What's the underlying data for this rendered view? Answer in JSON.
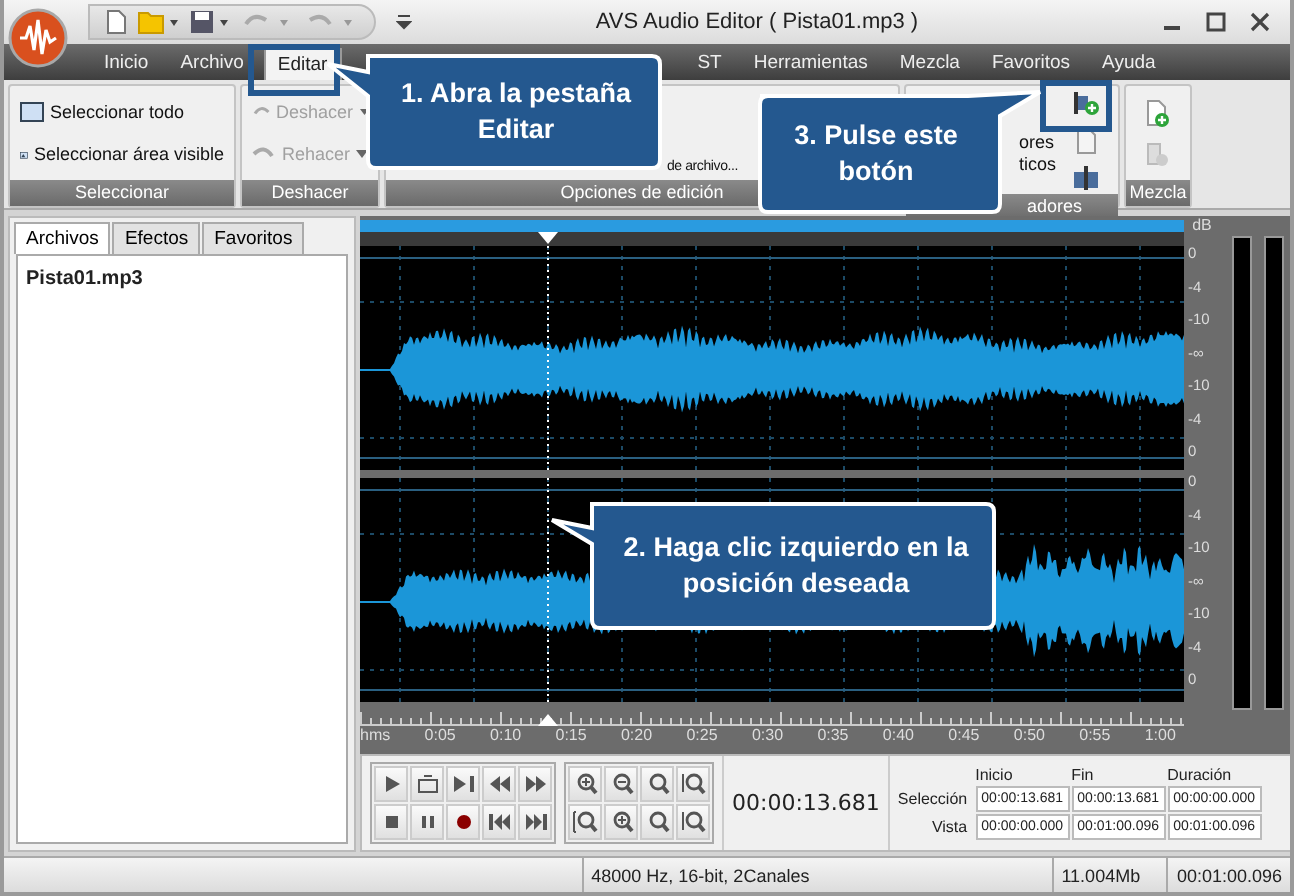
{
  "window": {
    "title": "AVS Audio Editor  ( Pista01.mp3 )"
  },
  "ribbon_tabs": [
    {
      "label": "Inicio",
      "selected": false
    },
    {
      "label": "Archivo",
      "selected": false
    },
    {
      "label": "Editar",
      "selected": true
    },
    {
      "label": "ST",
      "selected": false
    },
    {
      "label": "Herramientas",
      "selected": false
    },
    {
      "label": "Mezcla",
      "selected": false
    },
    {
      "label": "Favoritos",
      "selected": false
    },
    {
      "label": "Ayuda",
      "selected": false
    }
  ],
  "ribbon_groups": [
    {
      "label": "Seleccionar",
      "buttons": [
        {
          "label": "Seleccionar todo",
          "disabled": false
        },
        {
          "label": "Seleccionar área visible",
          "disabled": false
        }
      ]
    },
    {
      "label": "Deshacer",
      "buttons": [
        {
          "label": "Deshacer",
          "disabled": true
        },
        {
          "label": "Rehacer",
          "disabled": true
        }
      ]
    },
    {
      "label": "Opciones de edición",
      "buttons": [
        {
          "label": "de archivo...",
          "disabled": false
        }
      ]
    },
    {
      "label": "adores",
      "buttons": [
        {
          "label": "ores\nticos",
          "disabled": false
        }
      ]
    },
    {
      "label": "Mezcla"
    }
  ],
  "panel_tabs": [
    {
      "label": "Archivos",
      "selected": true
    },
    {
      "label": "Efectos",
      "selected": false
    },
    {
      "label": "Favoritos",
      "selected": false
    }
  ],
  "files": [
    "Pista01.mp3"
  ],
  "db_scale": {
    "unit": "dB",
    "channels": [
      {
        "ticks": [
          "0",
          "-4",
          "-10",
          "-∞",
          "-10",
          "-4",
          "0"
        ]
      },
      {
        "ticks": [
          "0",
          "-4",
          "-10",
          "-∞",
          "-10",
          "-4",
          "0"
        ]
      }
    ]
  },
  "ruler": [
    "hms",
    "0:05",
    "0:10",
    "0:15",
    "0:20",
    "0:25",
    "0:30",
    "0:35",
    "0:40",
    "0:45",
    "0:50",
    "0:55",
    "1:00"
  ],
  "time_display": "00:00:13.681",
  "selection": {
    "columns": [
      "Inicio",
      "Fin",
      "Duración"
    ],
    "rows": [
      {
        "label": "Selección",
        "values": [
          "00:00:13.681",
          "00:00:13.681",
          "00:00:00.000"
        ]
      },
      {
        "label": "Vista",
        "values": [
          "00:00:00.000",
          "00:01:00.096",
          "00:01:00.096"
        ]
      }
    ]
  },
  "status_bar": [
    "48000 Hz, 16-bit, 2Canales",
    "11.004Mb",
    "00:01:00.096"
  ],
  "callouts": [
    {
      "text": "1. Abra la pestaña Editar",
      "highlight": true
    },
    {
      "text": "3. Pulse este botón",
      "highlight": true
    },
    {
      "text": "2. Haga clic izquierdo en la posición deseada",
      "highlight": false
    }
  ]
}
